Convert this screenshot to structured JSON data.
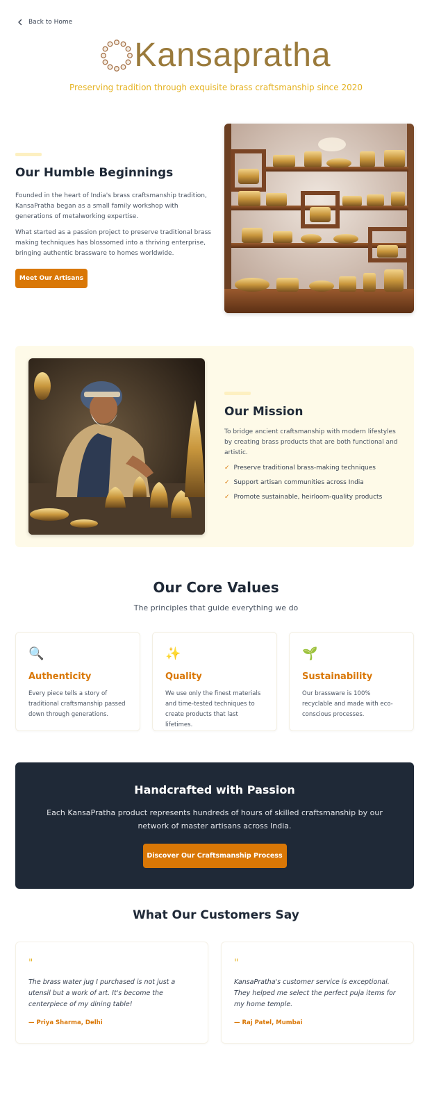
{
  "nav": {
    "back_label": "Back to Home"
  },
  "brand": {
    "name": "Kansapratha",
    "tagline": "Preserving tradition through exquisite brass craftsmanship since 2020",
    "color": "#9a7a3b",
    "tagline_color": "#e5b323"
  },
  "beginnings": {
    "title": "Our Humble Beginnings",
    "p1": "Founded in the heart of India's brass craftsmanship tradition, KansaPratha began as a small family workshop with generations of metalworking expertise.",
    "p2": "What started as a passion project to preserve traditional brass making techniques has blossomed into a thriving enterprise, bringing authentic brassware to homes worldwide.",
    "button": "Meet Our Artisans"
  },
  "mission": {
    "title": "Our Mission",
    "text": "To bridge ancient craftsmanship with modern lifestyles by creating brass products that are both functional and artistic.",
    "check_icon": "✓",
    "points": [
      "Preserve traditional brass-making techniques",
      "Support artisan communities across India",
      "Promote sustainable, heirloom-quality products"
    ]
  },
  "values": {
    "title": "Our Core Values",
    "subtitle": "The principles that guide everything we do",
    "cards": [
      {
        "icon": "🔍",
        "icon_name": "magnifier-icon",
        "title": "Authenticity",
        "text": "Every piece tells a story of traditional craftsmanship passed down through generations."
      },
      {
        "icon": "✨",
        "icon_name": "sparkles-icon",
        "title": "Quality",
        "text": "We use only the finest materials and time-tested techniques to create products that last lifetimes."
      },
      {
        "icon": "🌱",
        "icon_name": "seedling-icon",
        "title": "Sustainability",
        "text": "Our brassware is 100% recyclable and made with eco-conscious processes."
      }
    ]
  },
  "passion": {
    "title": "Handcrafted with Passion",
    "text": "Each KansaPratha product represents hundreds of hours of skilled craftsmanship by our network of master artisans across India.",
    "button": "Discover Our Craftsmanship Process"
  },
  "testimonials": {
    "title": "What Our Customers Say",
    "quote_mark": "\"",
    "items": [
      {
        "text": "The brass water jug I purchased is not just a utensil but a work of art. It's become the centerpiece of my dining table!",
        "author": "— Priya Sharma, Delhi"
      },
      {
        "text": "KansaPratha's customer service is exceptional. They helped me select the perfect puja items for my home temple.",
        "author": "— Raj Patel, Mumbai"
      }
    ]
  },
  "colors": {
    "accent": "#d97706",
    "dark": "#1f2937",
    "cream": "#fefae8"
  }
}
